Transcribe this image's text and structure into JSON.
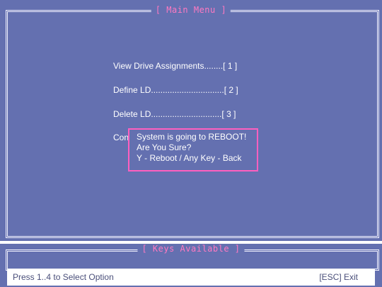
{
  "main_menu": {
    "title": "[ Main Menu ]",
    "items": [
      {
        "label": "View Drive Assignments",
        "dots": "........",
        "key": "[ 1 ]"
      },
      {
        "label": "Define LD",
        "dots": "...............................",
        "key": "[ 2 ]"
      },
      {
        "label": "Delete LD",
        "dots": "..............................",
        "key": "[ 3 ]"
      },
      {
        "label": "Con",
        "dots": "",
        "key": ""
      }
    ]
  },
  "dialog": {
    "line1": "System is going to REBOOT!",
    "line2": "Are You Sure?",
    "line3": "Y - Reboot / Any Key - Back"
  },
  "keys_panel": {
    "title": "[ Keys Available ]",
    "hint": "Press 1..4 to Select Option",
    "esc": "[ESC] Exit"
  },
  "colors": {
    "background": "#6470b0",
    "title_text": "#ff79c2",
    "dialog_border": "#ff5fbf",
    "text": "#ffffff"
  }
}
